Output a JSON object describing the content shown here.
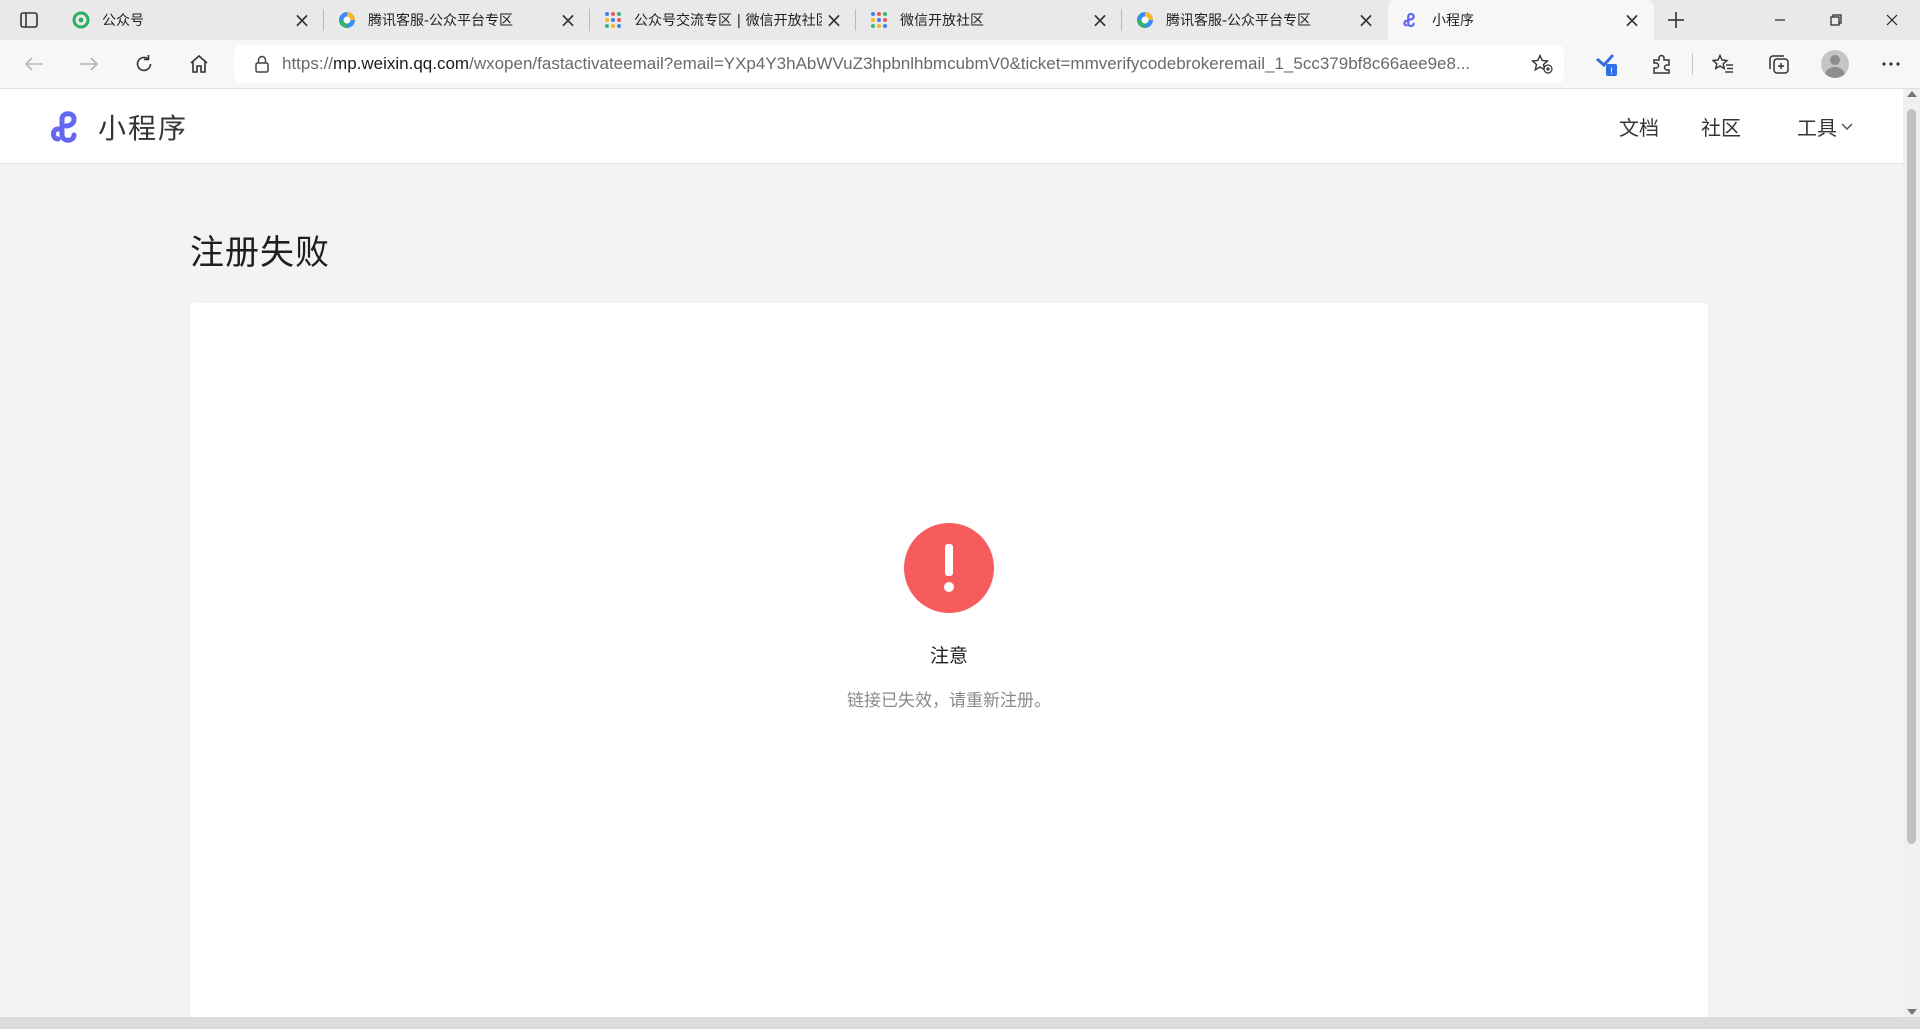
{
  "browser": {
    "tabs": [
      {
        "title": "公众号",
        "icon": "wechat-mp-icon",
        "active": false
      },
      {
        "title": "腾讯客服-公众平台专区",
        "icon": "tencent-cs-icon",
        "active": false
      },
      {
        "title": "公众号交流专区 | 微信开放社区",
        "icon": "wechat-dev-icon",
        "active": false
      },
      {
        "title": "微信开放社区",
        "icon": "wechat-dev-icon",
        "active": false
      },
      {
        "title": "腾讯客服-公众平台专区",
        "icon": "tencent-cs-icon",
        "active": false
      },
      {
        "title": "小程序",
        "icon": "miniprogram-icon",
        "active": true
      }
    ],
    "url_prefix": "https://",
    "url_host": "mp.weixin.qq.com",
    "url_path": "/wxopen/fastactivateemail?email=YXp4Y3hAbWVuZ3hpbnlhbmcubmV0&ticket=mmverifycodebrokeremail_1_5cc379bf8c66aee9e8..."
  },
  "site": {
    "logo_text": "小程序",
    "nav": {
      "docs": "文档",
      "community": "社区",
      "tools": "工具"
    }
  },
  "page": {
    "title": "注册失败",
    "alert_title": "注意",
    "alert_desc": "链接已失效，请重新注册。"
  },
  "colors": {
    "brand": "#6467f0",
    "alert": "#f65c5e"
  }
}
